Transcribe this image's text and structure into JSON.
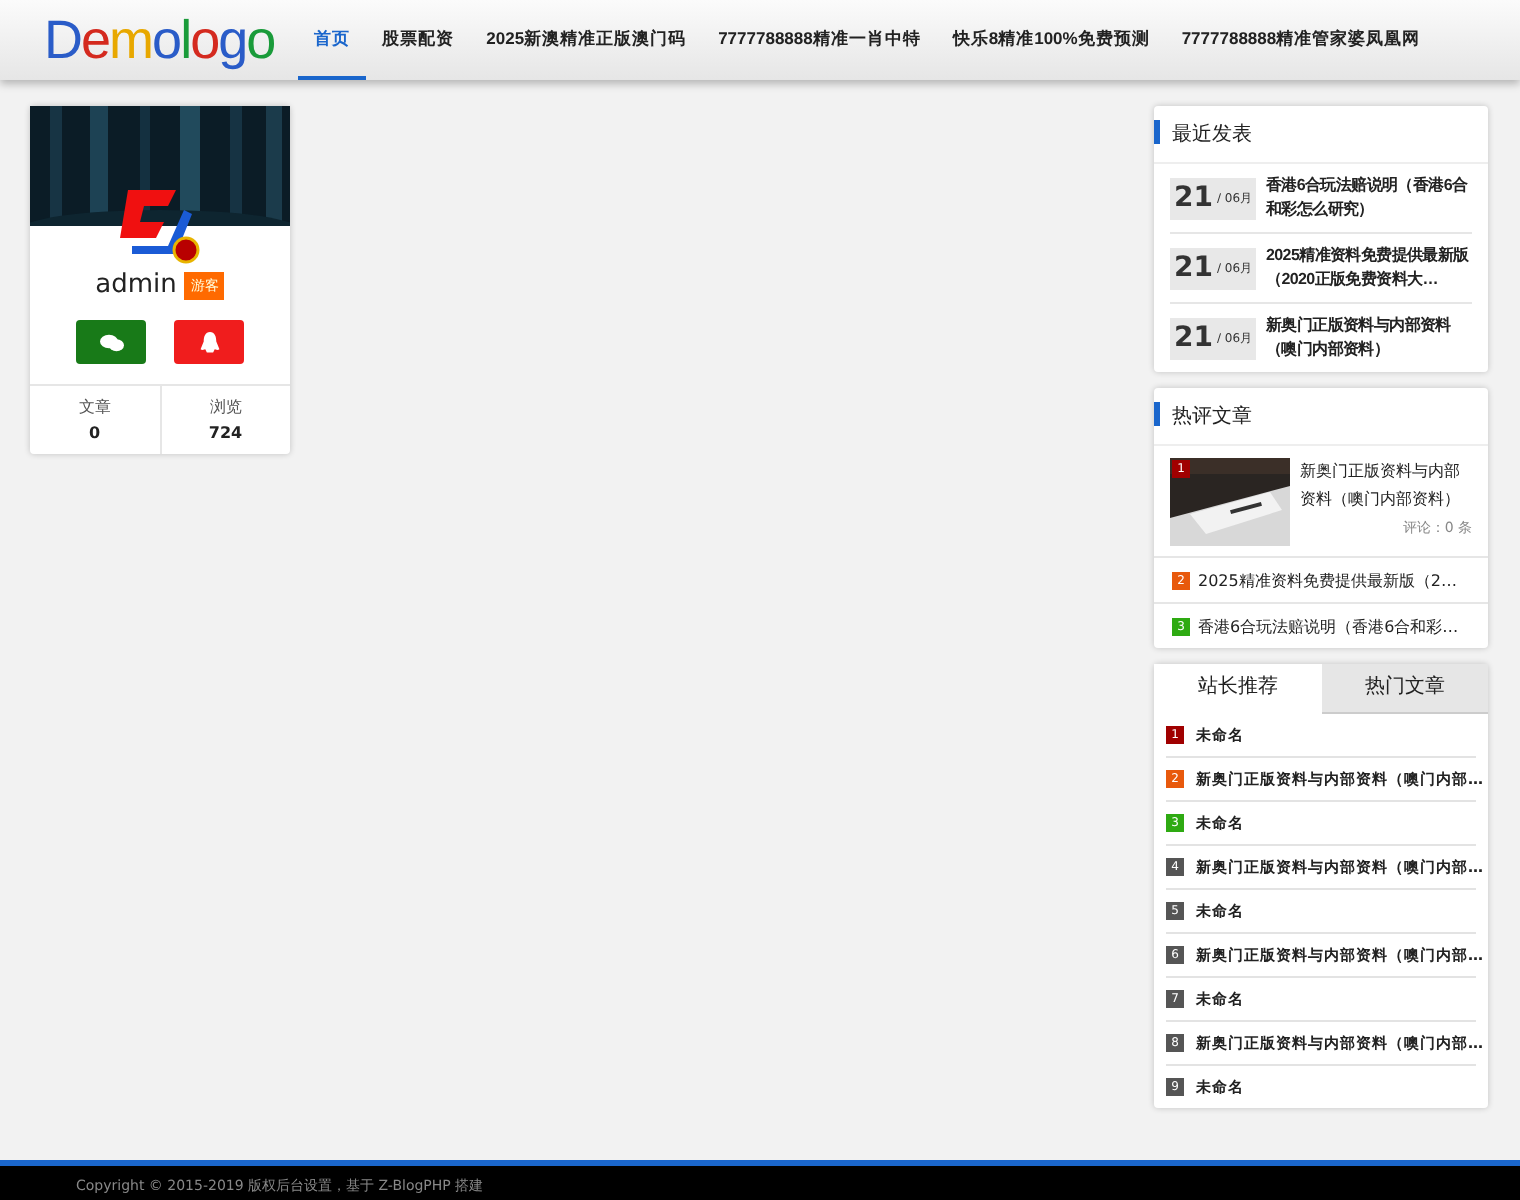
{
  "logo": "Demologo",
  "nav": [
    {
      "label": "首页",
      "selected": true
    },
    {
      "label": "股票配资",
      "selected": false
    },
    {
      "label": "2025新澳精准正版澳门码",
      "selected": false
    },
    {
      "label": "7777788888精准一肖中特",
      "selected": false
    },
    {
      "label": "快乐8精准100%免费预测",
      "selected": false
    },
    {
      "label": "7777788888精准管家婆凤凰网",
      "selected": false
    }
  ],
  "profile": {
    "name": "admin",
    "badge": "游客",
    "stats": [
      {
        "label": "文章",
        "value": "0"
      },
      {
        "label": "浏览",
        "value": "724"
      }
    ]
  },
  "recent": {
    "title": "最近发表",
    "items": [
      {
        "day": "21",
        "month": "/ 06月",
        "title": "香港6合玩法赔说明（香港6合和彩怎么研究）"
      },
      {
        "day": "21",
        "month": "/ 06月",
        "title": "2025精准资料免费提供最新版（2020正版免费资料大…"
      },
      {
        "day": "21",
        "month": "/ 06月",
        "title": "新奥门正版资料与内部资料（噢门内部资料）"
      }
    ]
  },
  "hot": {
    "title": "热评文章",
    "featured": {
      "rank": "1",
      "color": "#a00000",
      "title": "新奥门正版资料与内部资料（噢门内部资料）",
      "comments": "评论：0 条"
    },
    "items": [
      {
        "rank": "2",
        "color": "#e8590c",
        "title": "2025精准资料免费提供最新版（2…"
      },
      {
        "rank": "3",
        "color": "#2eaa12",
        "title": "香港6合玩法赔说明（香港6合和彩…"
      }
    ]
  },
  "tabs": [
    {
      "label": "站长推荐",
      "selected": true
    },
    {
      "label": "热门文章",
      "selected": false
    }
  ],
  "ranked": [
    {
      "rank": "1",
      "color": "#a00000",
      "title": "未命名"
    },
    {
      "rank": "2",
      "color": "#e8590c",
      "title": "新奥门正版资料与内部资料（噢门内部…"
    },
    {
      "rank": "3",
      "color": "#2eaa12",
      "title": "未命名"
    },
    {
      "rank": "4",
      "color": "#555555",
      "title": "新奥门正版资料与内部资料（噢门内部…"
    },
    {
      "rank": "5",
      "color": "#555555",
      "title": "未命名"
    },
    {
      "rank": "6",
      "color": "#555555",
      "title": "新奥门正版资料与内部资料（噢门内部…"
    },
    {
      "rank": "7",
      "color": "#555555",
      "title": "未命名"
    },
    {
      "rank": "8",
      "color": "#555555",
      "title": "新奥门正版资料与内部资料（噢门内部…"
    },
    {
      "rank": "9",
      "color": "#555555",
      "title": "未命名"
    }
  ],
  "footer": "Copyright © 2015-2019 版权后台设置，基于 Z-BlogPHP 搭建"
}
